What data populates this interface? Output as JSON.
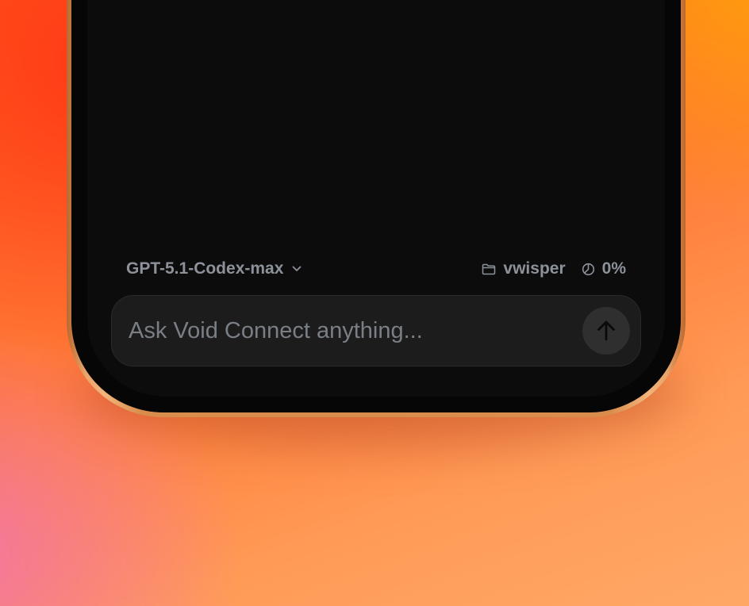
{
  "toolbar": {
    "model_label": "GPT-5.1-Codex-max",
    "folder_label": "vwisper",
    "context_usage": "0%"
  },
  "composer": {
    "placeholder": "Ask Void Connect anything..."
  },
  "icons": {
    "model_chevron": "chevron-down-icon",
    "folder": "folder-icon",
    "context": "pie-chart-icon",
    "send": "arrow-up-icon"
  },
  "colors": {
    "screen": "#0c0c0c",
    "input_bg": "#1c1c1c",
    "send_button": "#2f2f2f",
    "muted_text": "#8d929a",
    "frame": "#d98d4c"
  }
}
